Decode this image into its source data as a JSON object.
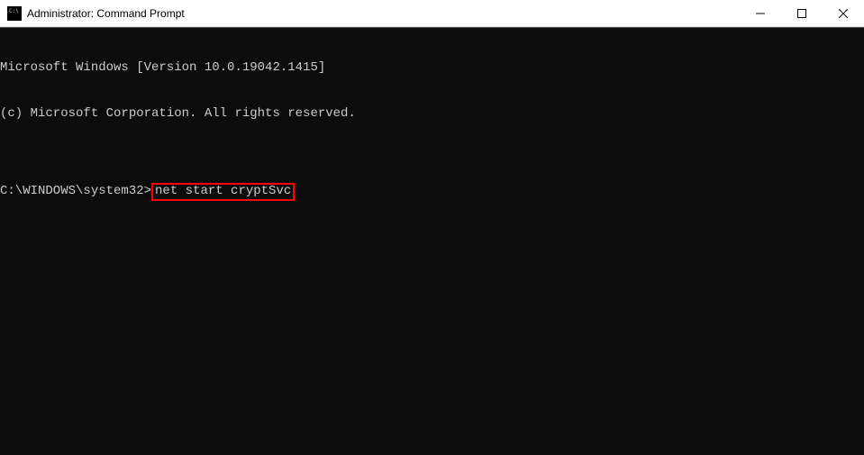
{
  "titlebar": {
    "title": "Administrator: Command Prompt"
  },
  "terminal": {
    "line1": "Microsoft Windows [Version 10.0.19042.1415]",
    "line2": "(c) Microsoft Corporation. All rights reserved.",
    "blank": "",
    "prompt": "C:\\WINDOWS\\system32>",
    "command": "net start cryptSvc"
  }
}
